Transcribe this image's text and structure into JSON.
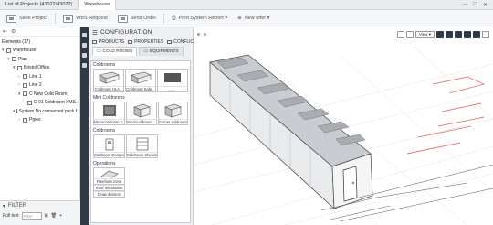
{
  "window": {
    "tabs": [
      {
        "label": "List of Projects (43022/43022)"
      },
      {
        "label": "Warehouse"
      }
    ],
    "controls": [
      "–",
      "□",
      "✕"
    ]
  },
  "toolbar": {
    "save_project": "Save Project",
    "wbs_request": "WBS Request",
    "send_order": "Send Order",
    "print_report": "Print System Report ▾",
    "new_offer": "New offer ▾"
  },
  "tree": {
    "header": "Elements (17)",
    "nodes": [
      {
        "label": "Warehouse",
        "level": 1
      },
      {
        "label": "Plan",
        "level": 2
      },
      {
        "label": "Bristol Office",
        "level": 3
      },
      {
        "label": "Line 1",
        "level": 4
      },
      {
        "label": "Line 2",
        "level": 4
      },
      {
        "label": "C New Cold Room",
        "level": 4
      },
      {
        "label": "C-01 Coldroom XMS...",
        "level": 5
      },
      {
        "label": "System No connected pack f...",
        "level": 3
      },
      {
        "label": "Pipes",
        "level": 4
      }
    ]
  },
  "filter": {
    "title": "FILTER",
    "fulltext_label": "Full text",
    "placeholder": "Filter"
  },
  "config": {
    "title": "CONFIGURATION",
    "tabs": [
      {
        "label": "PRODUCTS"
      },
      {
        "label": "PROPERTIES"
      },
      {
        "label": "CONFLICTS"
      }
    ],
    "subtabs": [
      {
        "label": "COLD ROOMS"
      },
      {
        "label": "EQUIPMENTS"
      }
    ],
    "categories": [
      {
        "label": "Coldrooms",
        "items": [
          "Coldroom HLA...",
          "Coldroom Safe...",
          "..."
        ]
      },
      {
        "label": "Mini Coldrooms",
        "items": [
          "Microcoldroom F...",
          "Microcoldroom...",
          "Corner coldroom"
        ]
      },
      {
        "label": "Coldrooms",
        "items": [
          "Coldroom Components",
          "Coldroom Shelvings"
        ]
      },
      {
        "label": "Operations",
        "items": [
          "Freeform zone",
          "Roof orientation",
          "Draw division"
        ]
      }
    ]
  },
  "viewport": {
    "view_select": "View ▾"
  }
}
